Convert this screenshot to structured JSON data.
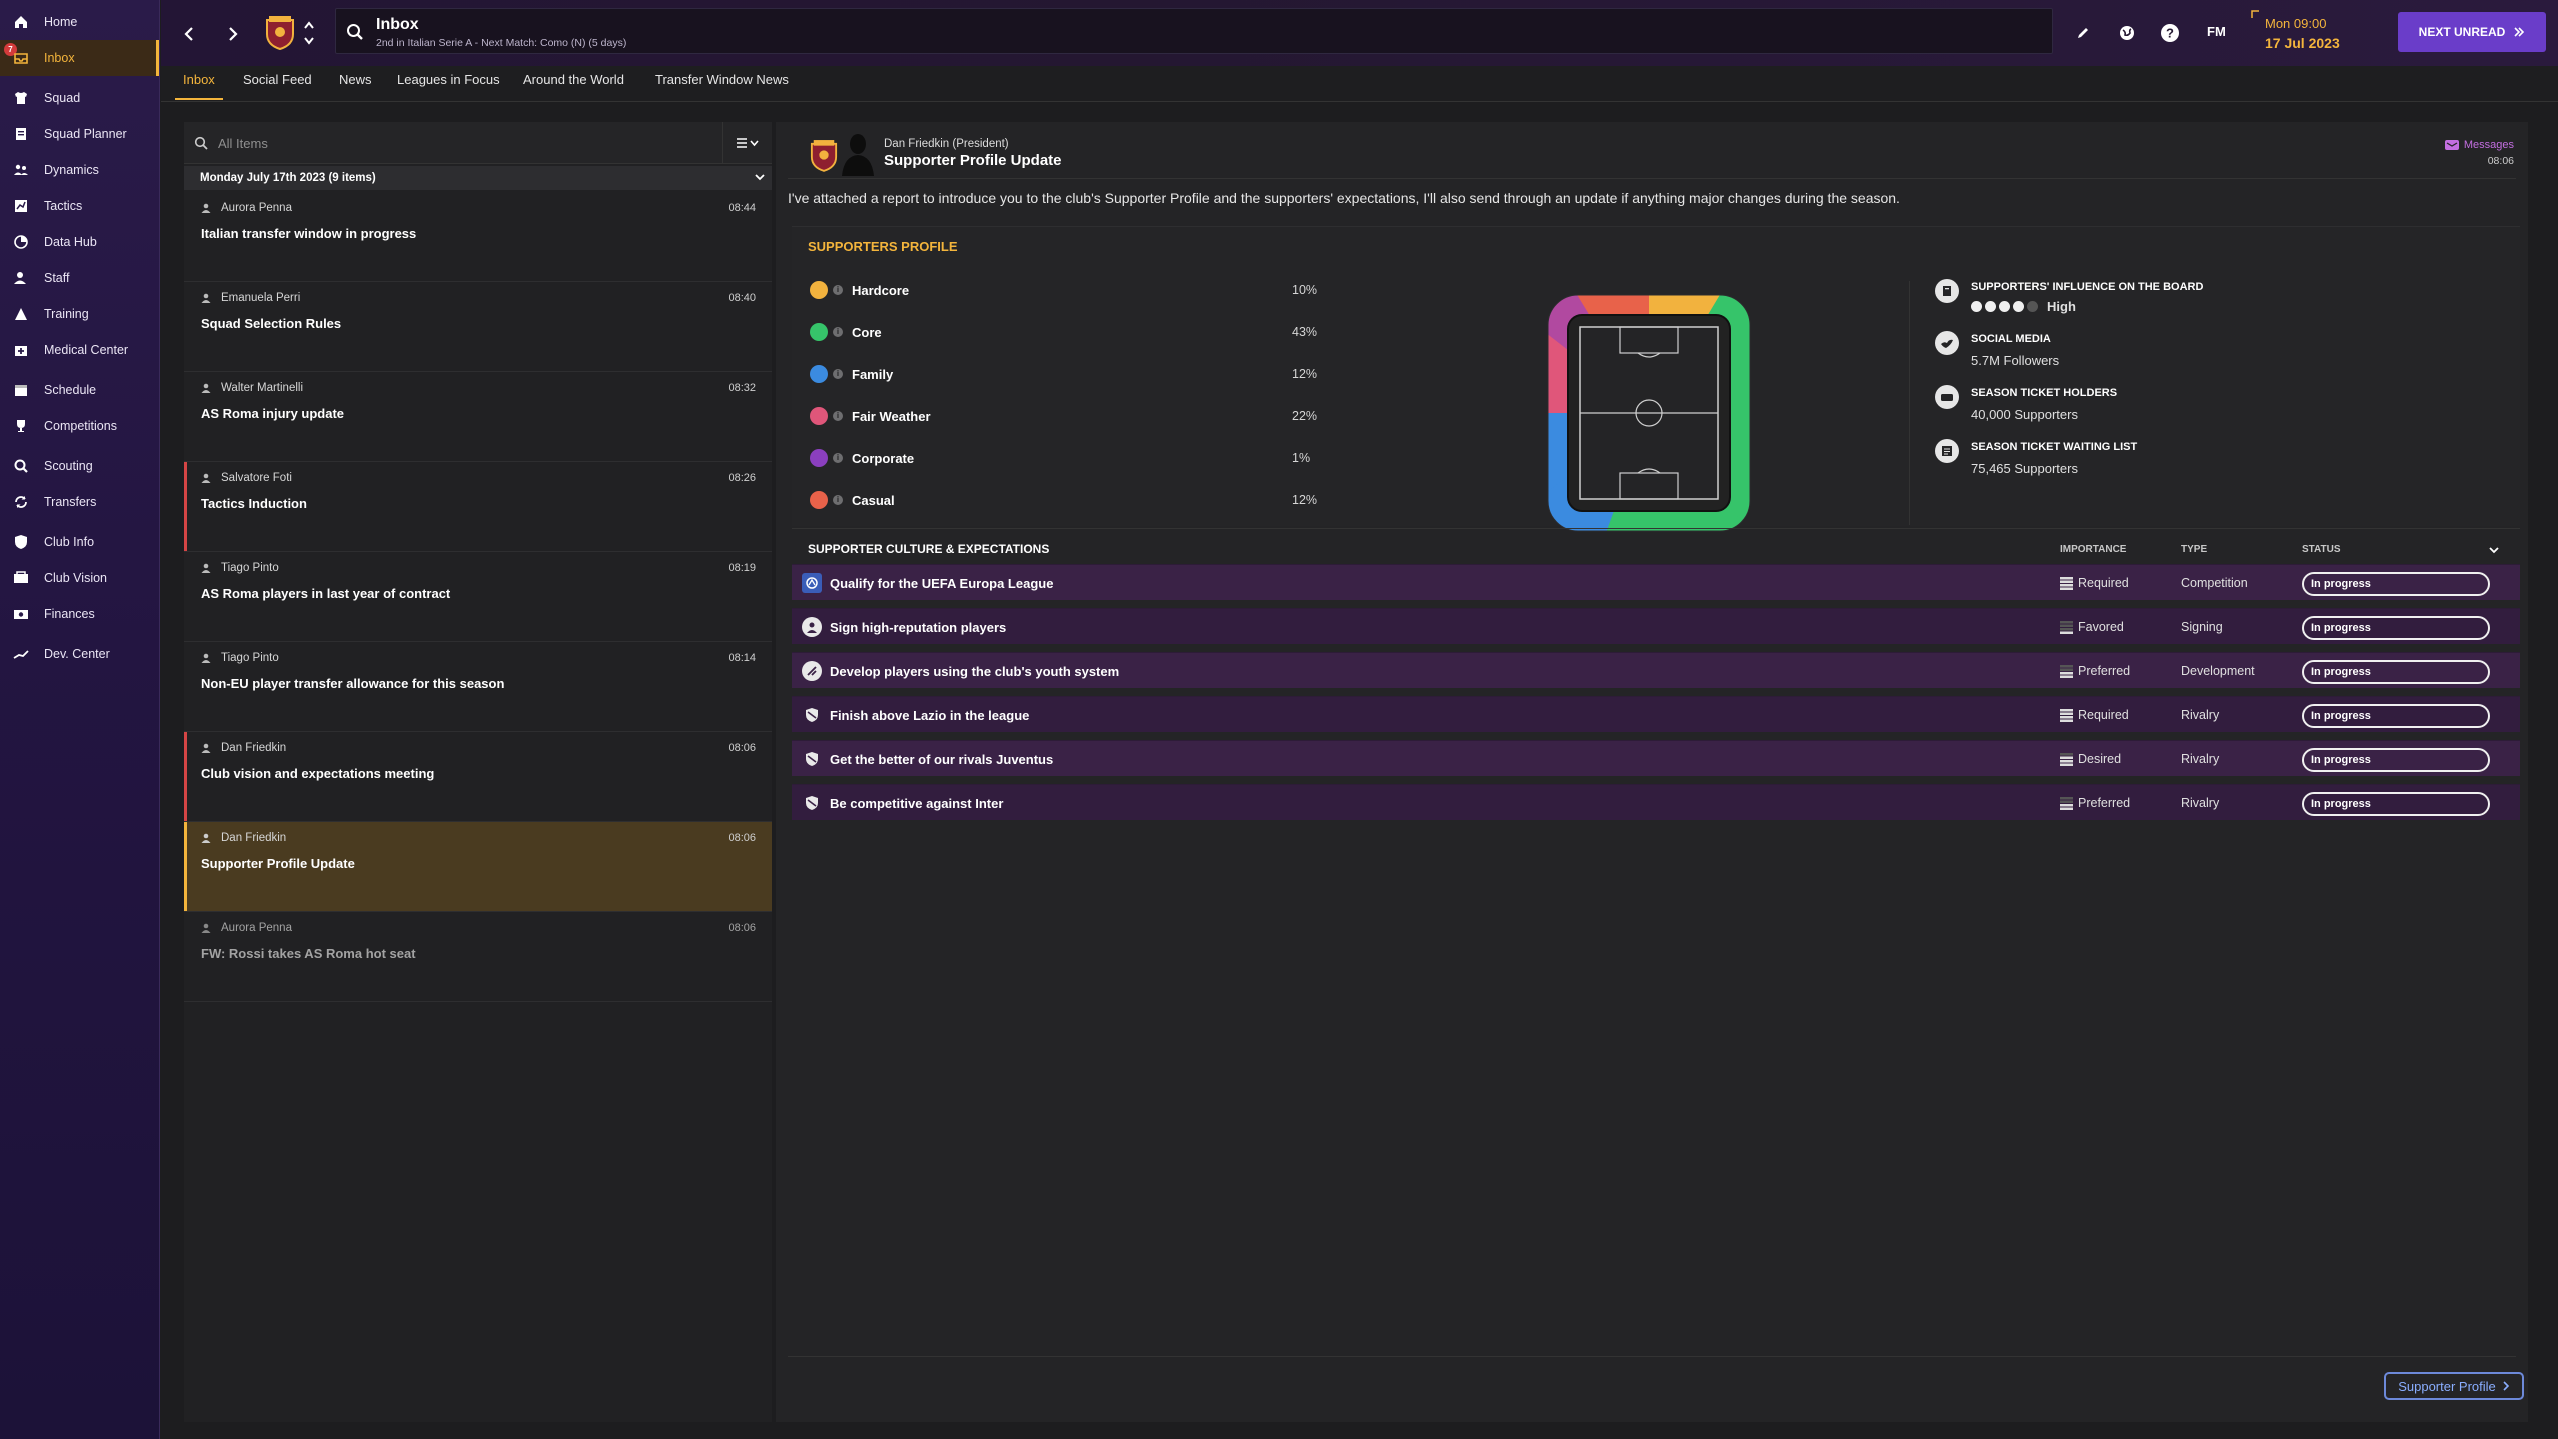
{
  "sidebar": {
    "items": [
      {
        "label": "Home",
        "icon": "home-icon"
      },
      {
        "label": "Inbox",
        "icon": "inbox-icon",
        "badge": "7",
        "active": true
      },
      {
        "label": "Squad",
        "icon": "shirt-icon"
      },
      {
        "label": "Squad Planner",
        "icon": "planner-icon"
      },
      {
        "label": "Dynamics",
        "icon": "dynamics-icon"
      },
      {
        "label": "Tactics",
        "icon": "tactics-icon"
      },
      {
        "label": "Data Hub",
        "icon": "data-hub-icon"
      },
      {
        "label": "Staff",
        "icon": "staff-icon"
      },
      {
        "label": "Training",
        "icon": "training-icon"
      },
      {
        "label": "Medical Center",
        "icon": "medical-icon"
      },
      {
        "label": "Schedule",
        "icon": "calendar-icon"
      },
      {
        "label": "Competitions",
        "icon": "trophy-icon"
      },
      {
        "label": "Scouting",
        "icon": "scouting-icon"
      },
      {
        "label": "Transfers",
        "icon": "transfers-icon"
      },
      {
        "label": "Club Info",
        "icon": "shield-icon"
      },
      {
        "label": "Club Vision",
        "icon": "vision-icon"
      },
      {
        "label": "Finances",
        "icon": "finances-icon"
      },
      {
        "label": "Dev. Center",
        "icon": "dev-center-icon"
      }
    ]
  },
  "header": {
    "title": "Inbox",
    "subtitle": "2nd in Italian Serie A - Next Match: Como (N) (5 days)",
    "fm_label": "FM",
    "date_time": "Mon 09:00",
    "date_day": "17 Jul 2023",
    "next_unread_label": "NEXT UNREAD"
  },
  "tabs": [
    "Inbox",
    "Social Feed",
    "News",
    "Leagues in Focus",
    "Around the World",
    "Transfer Window News"
  ],
  "list": {
    "search_placeholder": "All Items",
    "group_label": "Monday July 17th 2023 (9 items)",
    "messages": [
      {
        "sender": "Aurora Penna",
        "time": "08:44",
        "subject": "Italian transfer window in progress"
      },
      {
        "sender": "Emanuela Perri",
        "time": "08:40",
        "subject": "Squad Selection Rules"
      },
      {
        "sender": "Walter Martinelli",
        "time": "08:32",
        "subject": "AS Roma injury update"
      },
      {
        "sender": "Salvatore Foti",
        "time": "08:26",
        "subject": "Tactics Induction"
      },
      {
        "sender": "Tiago Pinto",
        "time": "08:19",
        "subject": "AS Roma players in last year of contract"
      },
      {
        "sender": "Tiago Pinto",
        "time": "08:14",
        "subject": "Non-EU player transfer allowance for this season"
      },
      {
        "sender": "Dan Friedkin",
        "time": "08:06",
        "subject": "Club vision and expectations meeting"
      },
      {
        "sender": "Dan Friedkin",
        "time": "08:06",
        "subject": "Supporter Profile Update"
      },
      {
        "sender": "Aurora Penna",
        "time": "08:06",
        "subject": "FW: Rossi takes AS Roma hot seat"
      }
    ]
  },
  "message": {
    "sender": "Dan Friedkin  (President)",
    "title": "Supporter Profile Update",
    "folder": "Messages",
    "time": "08:06",
    "body": "I've attached a report to introduce you to the club's Supporter Profile and the supporters' expectations, I'll also send through an update if anything major changes during the season."
  },
  "profile": {
    "heading": "SUPPORTERS PROFILE",
    "segments": [
      {
        "label": "Hardcore",
        "pct": "10%",
        "color": "#f2b23e"
      },
      {
        "label": "Core",
        "pct": "43%",
        "color": "#36c46a"
      },
      {
        "label": "Family",
        "pct": "12%",
        "color": "#3b8be0"
      },
      {
        "label": "Fair Weather",
        "pct": "22%",
        "color": "#e0567a"
      },
      {
        "label": "Corporate",
        "pct": "1%",
        "color": "#8b3fbf"
      },
      {
        "label": "Casual",
        "pct": "12%",
        "color": "#e8624a"
      }
    ],
    "stats": [
      {
        "label": "SUPPORTERS' INFLUENCE ON THE BOARD",
        "value": "High",
        "level": 4,
        "max": 5,
        "icon": "board-icon"
      },
      {
        "label": "SOCIAL MEDIA",
        "value": "5.7M Followers",
        "icon": "social-icon"
      },
      {
        "label": "SEASON TICKET HOLDERS",
        "value": "40,000 Supporters",
        "icon": "ticket-icon"
      },
      {
        "label": "SEASON TICKET WAITING LIST",
        "value": "75,465 Supporters",
        "icon": "waiting-list-icon"
      }
    ]
  },
  "culture": {
    "heading": "SUPPORTER CULTURE & EXPECTATIONS",
    "columns": {
      "importance": "IMPORTANCE",
      "type": "TYPE",
      "status": "STATUS"
    },
    "rows": [
      {
        "label": "Qualify for the UEFA Europa League",
        "importance": "Required",
        "type": "Competition",
        "status": "In progress",
        "icon": "europa-icon"
      },
      {
        "label": "Sign high-reputation players",
        "importance": "Favored",
        "type": "Signing",
        "status": "In progress",
        "icon": "player-icon"
      },
      {
        "label": "Develop players using the club's youth system",
        "importance": "Preferred",
        "type": "Development",
        "status": "In progress",
        "icon": "youth-icon"
      },
      {
        "label": "Finish above Lazio in the league",
        "importance": "Required",
        "type": "Rivalry",
        "status": "In progress",
        "icon": "rivalry-icon"
      },
      {
        "label": "Get the better of our rivals Juventus",
        "importance": "Desired",
        "type": "Rivalry",
        "status": "In progress",
        "icon": "rivalry-icon"
      },
      {
        "label": "Be competitive against Inter",
        "importance": "Preferred",
        "type": "Rivalry",
        "status": "In progress",
        "icon": "rivalry-icon"
      }
    ]
  },
  "footer": {
    "supporter_profile_label": "Supporter Profile"
  }
}
